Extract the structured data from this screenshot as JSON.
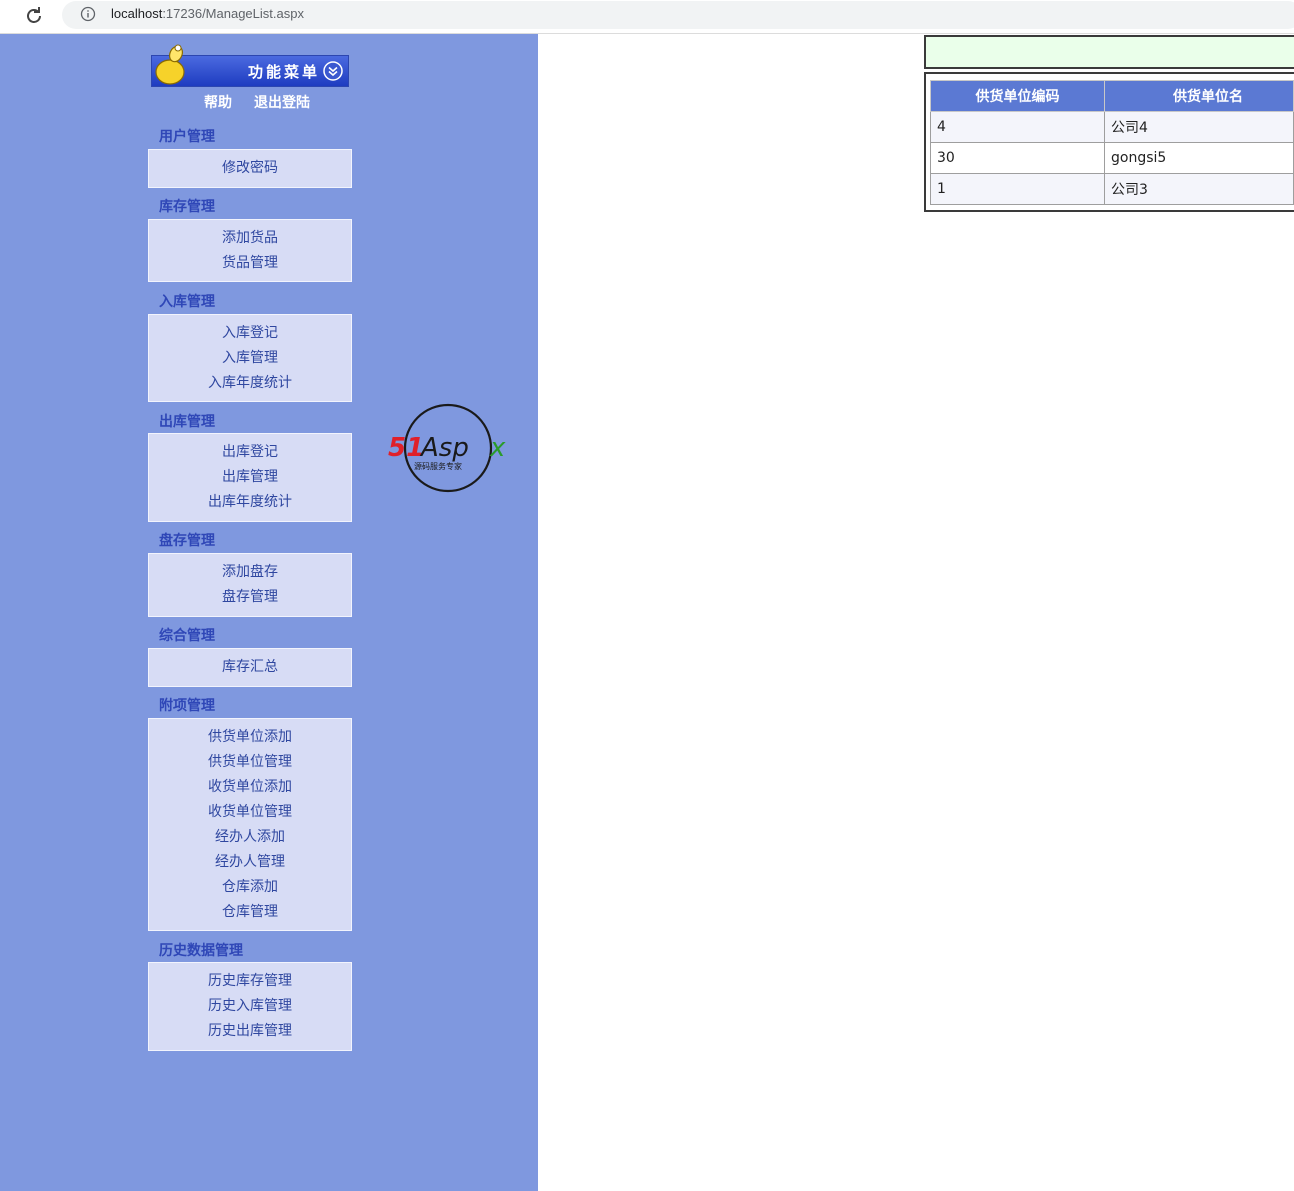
{
  "browser": {
    "url_host": "localhost",
    "url_path": ":17236/ManageList.aspx"
  },
  "sidebar": {
    "banner_title": "功能菜单",
    "top_links": [
      "帮助",
      "退出登陆"
    ],
    "groups": [
      {
        "title": "用户管理",
        "items": [
          "修改密码"
        ]
      },
      {
        "title": "库存管理",
        "items": [
          "添加货品",
          "货品管理"
        ]
      },
      {
        "title": "入库管理",
        "items": [
          "入库登记",
          "入库管理",
          "入库年度统计"
        ]
      },
      {
        "title": "出库管理",
        "items": [
          "出库登记",
          "出库管理",
          "出库年度统计"
        ]
      },
      {
        "title": "盘存管理",
        "items": [
          "添加盘存",
          "盘存管理"
        ]
      },
      {
        "title": "综合管理",
        "items": [
          "库存汇总"
        ]
      },
      {
        "title": "附项管理",
        "items": [
          "供货单位添加",
          "供货单位管理",
          "收货单位添加",
          "收货单位管理",
          "经办人添加",
          "经办人管理",
          "仓库添加",
          "仓库管理"
        ]
      },
      {
        "title": "历史数据管理",
        "items": [
          "历史库存管理",
          "历史入库管理",
          "历史出库管理"
        ]
      }
    ]
  },
  "watermark": {
    "brand_red": "51",
    "brand_dark": "Asp",
    "brand_green": "x",
    "tagline": "源码服务专家"
  },
  "table": {
    "headers": [
      "供货单位编码",
      "供货单位名"
    ],
    "rows": [
      [
        "4",
        "公司4"
      ],
      [
        "30",
        "gongsi5"
      ],
      [
        "1",
        "公司3"
      ]
    ]
  },
  "colors": {
    "sidebar_bg": "#7f98df",
    "group_title": "#2f47b7",
    "menu_box": "#d7dcf5",
    "table_header": "#5b79d3",
    "green_bar": "#eaffea"
  }
}
